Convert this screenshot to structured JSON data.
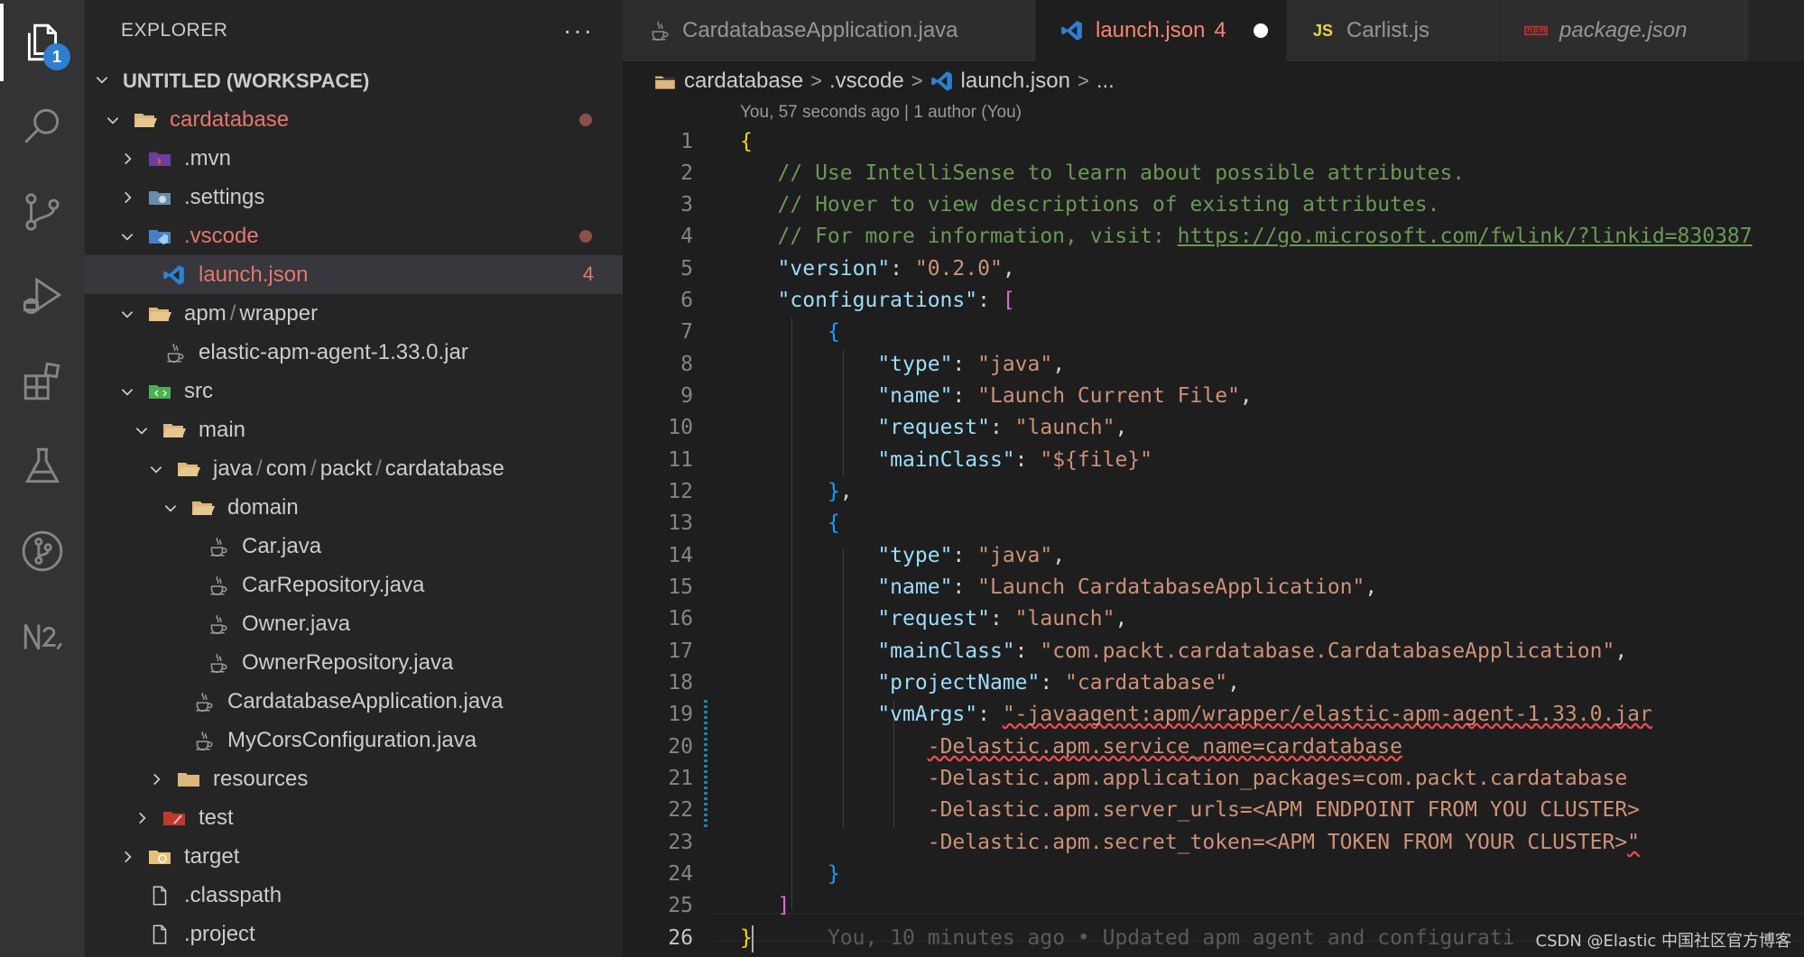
{
  "colors": {
    "accent": "#2f7fd0",
    "modified": "#e5776b",
    "error": "#f48771"
  },
  "activity_bar": {
    "items": [
      {
        "icon": "files-icon",
        "badge": "1"
      },
      {
        "icon": "search-icon"
      },
      {
        "icon": "source-control-icon"
      },
      {
        "icon": "run-debug-icon"
      },
      {
        "icon": "extensions-icon"
      },
      {
        "icon": "testing-icon"
      },
      {
        "icon": "git-graph-icon"
      },
      {
        "icon": "notebook-icon"
      }
    ]
  },
  "explorer": {
    "title": "EXPLORER",
    "more": "···",
    "workspace": "UNTITLED (WORKSPACE)",
    "tree": [
      {
        "label": "cardatabase",
        "depth": 0,
        "kind": "folder-open",
        "modified": true,
        "dot": true
      },
      {
        "label": ".mvn",
        "depth": 1,
        "kind": "folder-mvn",
        "collapsed": true
      },
      {
        "label": ".settings",
        "depth": 1,
        "kind": "folder-settings",
        "collapsed": true
      },
      {
        "label": ".vscode",
        "depth": 1,
        "kind": "folder-vscode",
        "modified": true,
        "dot": true
      },
      {
        "label": "launch.json",
        "depth": 2,
        "kind": "file-vscode",
        "modified": true,
        "count": "4",
        "selected": true
      },
      {
        "label": "apm",
        "label2": "wrapper",
        "depth": 1,
        "kind": "folder-open"
      },
      {
        "label": "elastic-apm-agent-1.33.0.jar",
        "depth": 2,
        "kind": "file-java"
      },
      {
        "label": "src",
        "depth": 1,
        "kind": "folder-src"
      },
      {
        "label": "main",
        "depth": 2,
        "kind": "folder-open"
      },
      {
        "label": "java",
        "label2": "com",
        "label3": "packt",
        "label4": "cardatabase",
        "depth": 3,
        "kind": "folder-open"
      },
      {
        "label": "domain",
        "depth": 4,
        "kind": "folder-open"
      },
      {
        "label": "Car.java",
        "depth": 5,
        "kind": "file-java"
      },
      {
        "label": "CarRepository.java",
        "depth": 5,
        "kind": "file-java"
      },
      {
        "label": "Owner.java",
        "depth": 5,
        "kind": "file-java"
      },
      {
        "label": "OwnerRepository.java",
        "depth": 5,
        "kind": "file-java"
      },
      {
        "label": "CardatabaseApplication.java",
        "depth": 4,
        "kind": "file-java"
      },
      {
        "label": "MyCorsConfiguration.java",
        "depth": 4,
        "kind": "file-java"
      },
      {
        "label": "resources",
        "depth": 3,
        "kind": "folder",
        "collapsed": true
      },
      {
        "label": "test",
        "depth": 2,
        "kind": "folder-test",
        "collapsed": true
      },
      {
        "label": "target",
        "depth": 1,
        "kind": "folder-target",
        "collapsed": true
      },
      {
        "label": ".classpath",
        "depth": 1,
        "kind": "file"
      },
      {
        "label": ".project",
        "depth": 1,
        "kind": "file"
      }
    ]
  },
  "tabs": [
    {
      "label": "CardatabaseApplication.java",
      "icon": "java-icon"
    },
    {
      "label": "launch.json",
      "icon": "vscode-icon",
      "count": "4",
      "dirty": true,
      "active": true
    },
    {
      "label": "Carlist.js",
      "icon": "js-icon",
      "icon_text": "JS"
    },
    {
      "label": "package.json",
      "icon": "npm-icon",
      "italic": true
    }
  ],
  "breadcrumb": [
    "cardatabase",
    ".vscode",
    "launch.json",
    "..."
  ],
  "blame_header": "You, 57 seconds ago | 1 author (You)",
  "editor": {
    "line_numbers": [
      "1",
      "2",
      "3",
      "4",
      "5",
      "6",
      "7",
      "8",
      "9",
      "10",
      "11",
      "12",
      "13",
      "14",
      "15",
      "16",
      "17",
      "18",
      "19",
      "20",
      "21",
      "22",
      "23",
      "24",
      "25",
      "26"
    ],
    "lines": {
      "l1": "{",
      "l2": "// Use IntelliSense to learn about possible attributes.",
      "l3": "// Hover to view descriptions of existing attributes.",
      "l4a": "// For more information, visit: ",
      "l4b": "https://go.microsoft.com/fwlink/?linkid=830387",
      "l5k": "\"version\"",
      "l5v": "\"0.2.0\"",
      "l6k": "\"configurations\"",
      "l7": "{",
      "l8k": "\"type\"",
      "l8v": "\"java\"",
      "l9k": "\"name\"",
      "l9v": "\"Launch Current File\"",
      "l10k": "\"request\"",
      "l10v": "\"launch\"",
      "l11k": "\"mainClass\"",
      "l11v": "\"${file}\"",
      "l12": "}",
      "l13": "{",
      "l14k": "\"type\"",
      "l14v": "\"java\"",
      "l15k": "\"name\"",
      "l15v": "\"Launch CardatabaseApplication\"",
      "l16k": "\"request\"",
      "l16v": "\"launch\"",
      "l17k": "\"mainClass\"",
      "l17v": "\"com.packt.cardatabase.CardatabaseApplication\"",
      "l18k": "\"projectName\"",
      "l18v": "\"cardatabase\"",
      "l19k": "\"vmArgs\"",
      "l19v": "\"-javaagent:apm/wrapper/elastic-apm-agent-1.33.0.jar",
      "l20": "-Delastic.apm.service_name=cardatabase",
      "l21": "-Delastic.apm.application_packages=com.packt.cardatabase",
      "l22": "-Delastic.apm.server_urls=<APM ENDPOINT FROM YOU CLUSTER>",
      "l23a": "-Delastic.apm.secret_token=<APM TOKEN FROM YOUR CLUSTER>",
      "l23b": "\"",
      "l24": "}",
      "l25": "]",
      "l26": "}",
      "l26blame": "You, 10 minutes ago • Updated apm agent and configurati"
    }
  },
  "watermark": "CSDN @Elastic 中国社区官方博客"
}
